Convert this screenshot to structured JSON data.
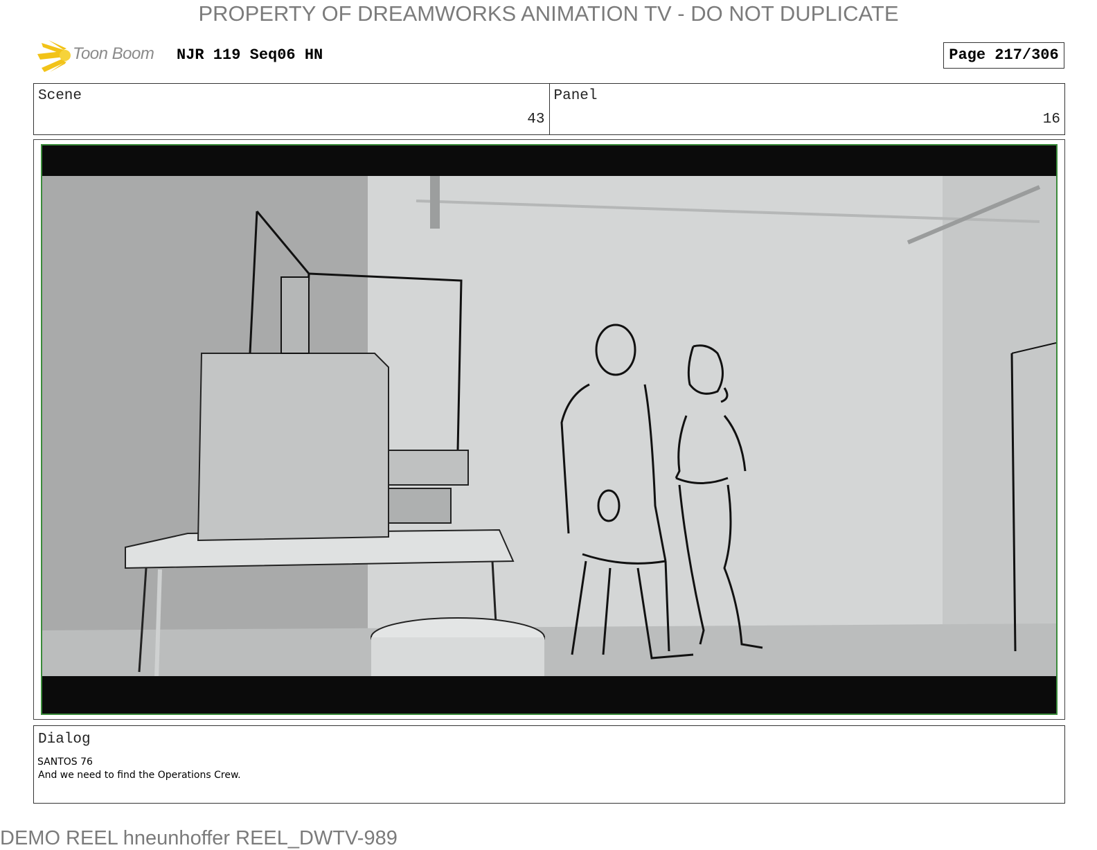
{
  "header": {
    "watermark": "PROPERTY OF DREAMWORKS ANIMATION TV - DO NOT DUPLICATE",
    "logo_text": "Toon Boom",
    "project_title": "NJR 119 Seq06 HN",
    "page": "Page 217/306"
  },
  "info": {
    "scene_label": "Scene",
    "scene_value": "43",
    "panel_label": "Panel",
    "panel_value": "16"
  },
  "panel": {
    "icons": [
      "toon-boom-logo-icon"
    ],
    "letterbox_color": "#0b0b0b",
    "frame_color": "#3a8a3a"
  },
  "dialog": {
    "label": "Dialog",
    "speaker": "SANTOS 76",
    "line": "And we need to find the Operations Crew."
  },
  "footer": {
    "watermark": "DEMO REEL hneunhoffer REEL_DWTV-989"
  }
}
